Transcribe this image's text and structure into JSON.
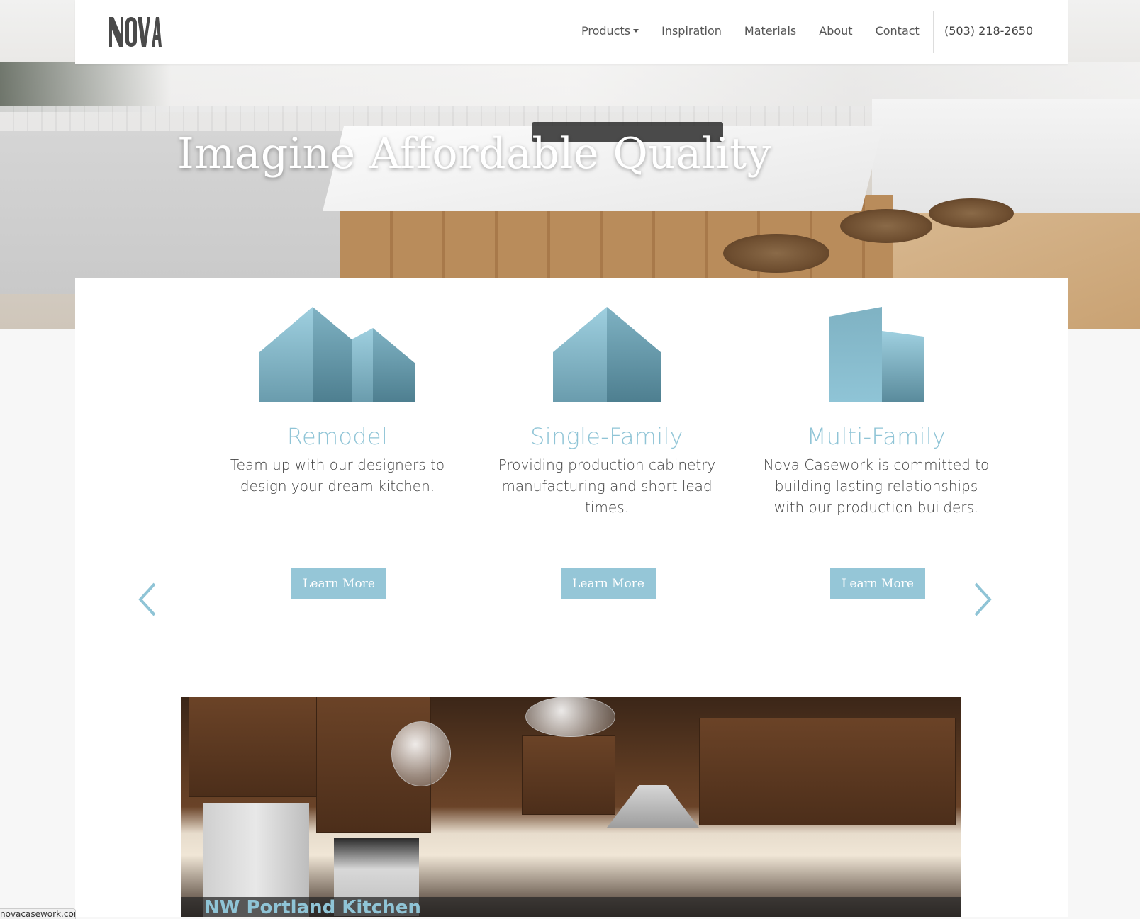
{
  "brand": {
    "logo_text": "NOVA"
  },
  "nav": {
    "items": [
      {
        "label": "Products",
        "has_dropdown": true
      },
      {
        "label": "Inspiration",
        "has_dropdown": false
      },
      {
        "label": "Materials",
        "has_dropdown": false
      },
      {
        "label": "About",
        "has_dropdown": false
      },
      {
        "label": "Contact",
        "has_dropdown": false
      }
    ],
    "phone": "(503) 218-2650"
  },
  "hero": {
    "title": "Imagine Affordable Quality"
  },
  "features": [
    {
      "title": "Remodel",
      "description": "Team up with our designers to design your dream kitchen.",
      "button": "Learn More",
      "icon": "multi-house-icon"
    },
    {
      "title": "Single-Family",
      "description": "Providing production cabinetry manufacturing and short lead times.",
      "button": "Learn More",
      "icon": "house-icon"
    },
    {
      "title": "Multi-Family",
      "description": "Nova Casework is committed to building lasting relationships with our production builders.",
      "button": "Learn More",
      "icon": "building-icon"
    }
  ],
  "carousel": {
    "caption": "NW Portland Kitchen",
    "prev_icon": "chevron-left-icon",
    "next_icon": "chevron-right-icon"
  },
  "status_bar": {
    "url": "novacasework.com"
  },
  "colors": {
    "accent": "#95c6d7",
    "accent_text": "#8fc4d6",
    "nav_text": "#555555"
  }
}
